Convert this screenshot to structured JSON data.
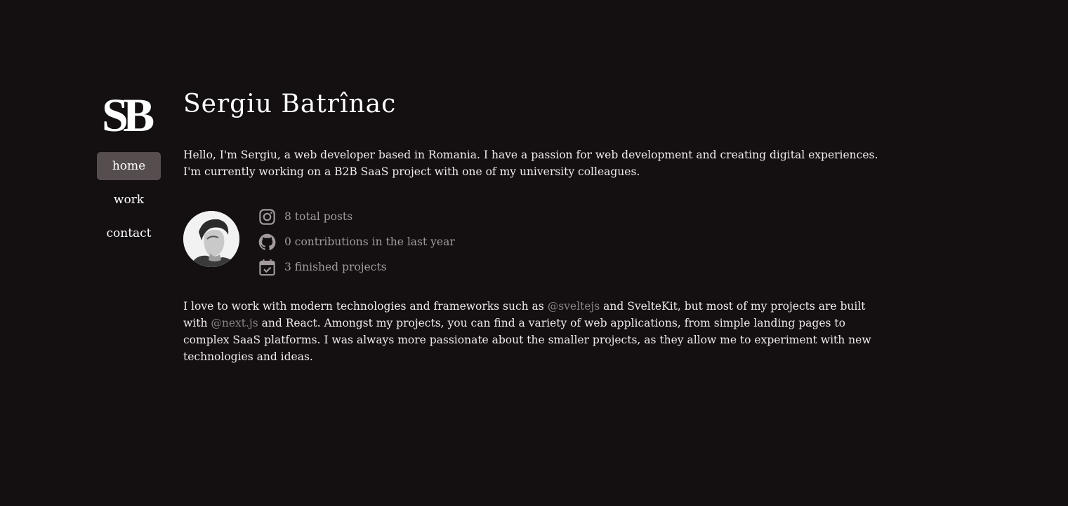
{
  "logo": {
    "text": "SB"
  },
  "nav": {
    "items": [
      {
        "label": "home",
        "active": true
      },
      {
        "label": "work",
        "active": false
      },
      {
        "label": "contact",
        "active": false
      }
    ]
  },
  "main": {
    "title": "Sergiu Batrînac",
    "intro": "Hello, I'm Sergiu, a web developer based in Romania. I have a passion for web development and creating digital experiences. I'm currently working on a B2B SaaS project with one of my university colleagues.",
    "stats": [
      {
        "icon": "instagram-icon",
        "text": "8 total posts"
      },
      {
        "icon": "github-icon",
        "text": "0 contributions in the last year"
      },
      {
        "icon": "calendar-check-icon",
        "text": "3 finished projects"
      }
    ],
    "about": {
      "part1": "I love to work with modern technologies and frameworks such as ",
      "mention1": "@sveltejs",
      "part2": " and SvelteKit, but most of my projects are built with ",
      "mention2": "@next.js",
      "part3": " and React. Amongst my projects, you can find a variety of web applications, from simple landing pages to complex SaaS platforms. I was always more passionate about the smaller projects, as they allow me to experiment with new technologies and ideas."
    }
  },
  "colors": {
    "background": "#141011",
    "text": "#f1ecec",
    "muted": "#a29a9b",
    "nav_active_bg": "#564d4e"
  }
}
